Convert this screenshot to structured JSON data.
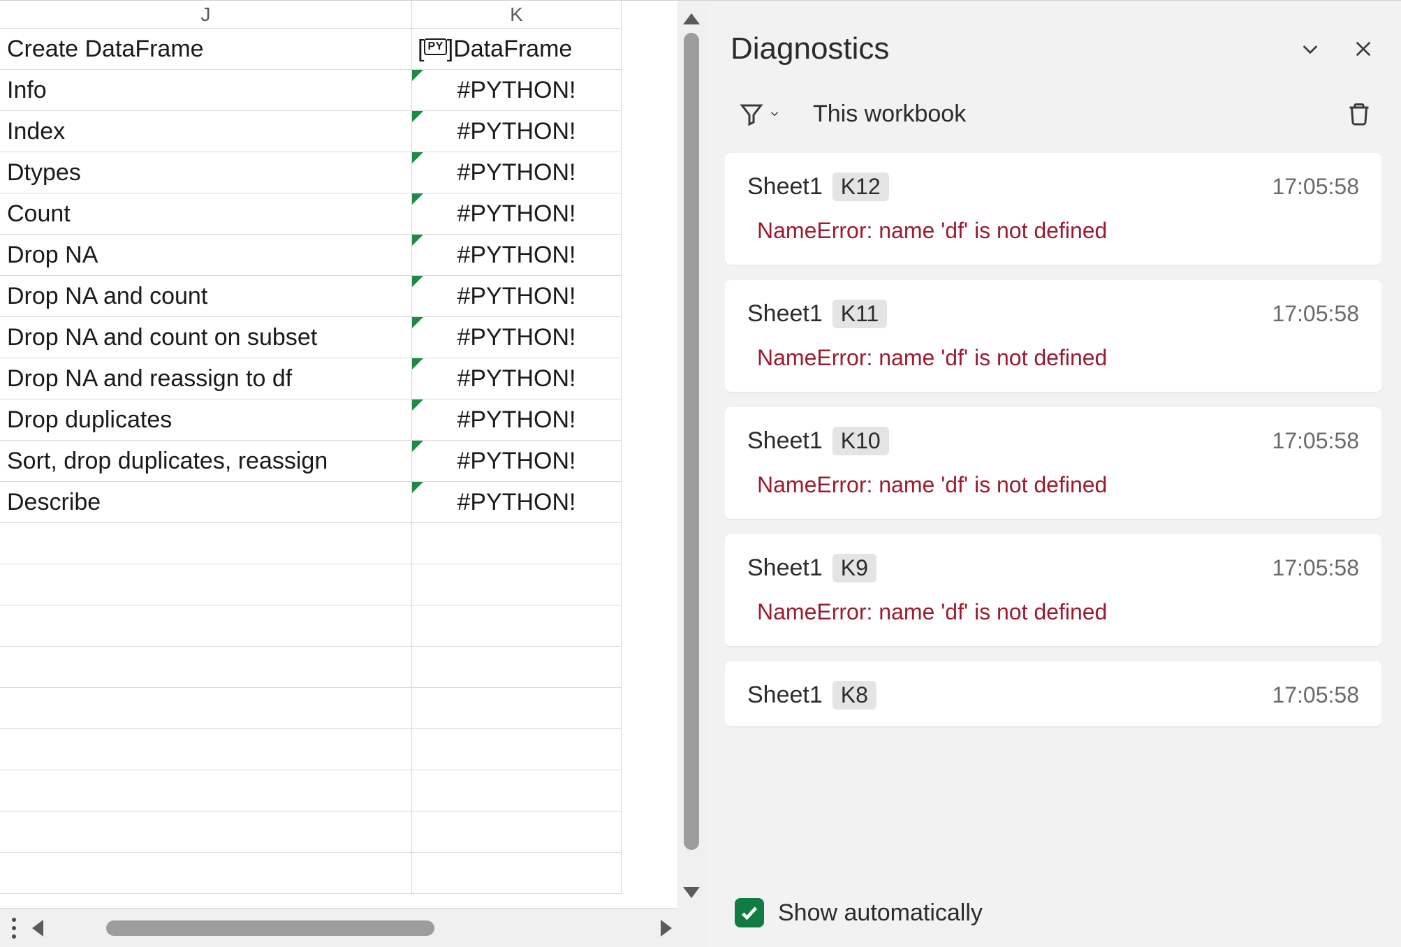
{
  "grid": {
    "columns": [
      "J",
      "K"
    ],
    "rows": [
      {
        "j": "Create DataFrame",
        "k_kind": "obj",
        "k_prefix": "PY",
        "k_value": "DataFrame"
      },
      {
        "j": "Info",
        "k_kind": "err",
        "k_value": "#PYTHON!"
      },
      {
        "j": "Index",
        "k_kind": "err",
        "k_value": "#PYTHON!"
      },
      {
        "j": "Dtypes",
        "k_kind": "err",
        "k_value": "#PYTHON!"
      },
      {
        "j": "Count",
        "k_kind": "err",
        "k_value": "#PYTHON!"
      },
      {
        "j": "Drop NA",
        "k_kind": "err",
        "k_value": "#PYTHON!"
      },
      {
        "j": "Drop NA and count",
        "k_kind": "err",
        "k_value": "#PYTHON!"
      },
      {
        "j": "Drop NA and count on subset",
        "k_kind": "err",
        "k_value": "#PYTHON!"
      },
      {
        "j": "Drop NA and reassign to df",
        "k_kind": "err",
        "k_value": "#PYTHON!"
      },
      {
        "j": "Drop duplicates",
        "k_kind": "err",
        "k_value": "#PYTHON!"
      },
      {
        "j": "Sort, drop duplicates, reassign",
        "k_kind": "err",
        "k_value": "#PYTHON!"
      },
      {
        "j": "Describe",
        "k_kind": "err",
        "k_value": "#PYTHON!"
      }
    ],
    "blank_rows": 9
  },
  "diagnostics": {
    "title": "Diagnostics",
    "scope": "This workbook",
    "show_auto_label": "Show automatically",
    "show_auto_checked": true,
    "items": [
      {
        "sheet": "Sheet1",
        "cell": "K12",
        "time": "17:05:58",
        "message": "NameError: name 'df' is not defined"
      },
      {
        "sheet": "Sheet1",
        "cell": "K11",
        "time": "17:05:58",
        "message": "NameError: name 'df' is not defined"
      },
      {
        "sheet": "Sheet1",
        "cell": "K10",
        "time": "17:05:58",
        "message": "NameError: name 'df' is not defined"
      },
      {
        "sheet": "Sheet1",
        "cell": "K9",
        "time": "17:05:58",
        "message": "NameError: name 'df' is not defined"
      },
      {
        "sheet": "Sheet1",
        "cell": "K8",
        "time": "17:05:58",
        "message": ""
      }
    ]
  }
}
